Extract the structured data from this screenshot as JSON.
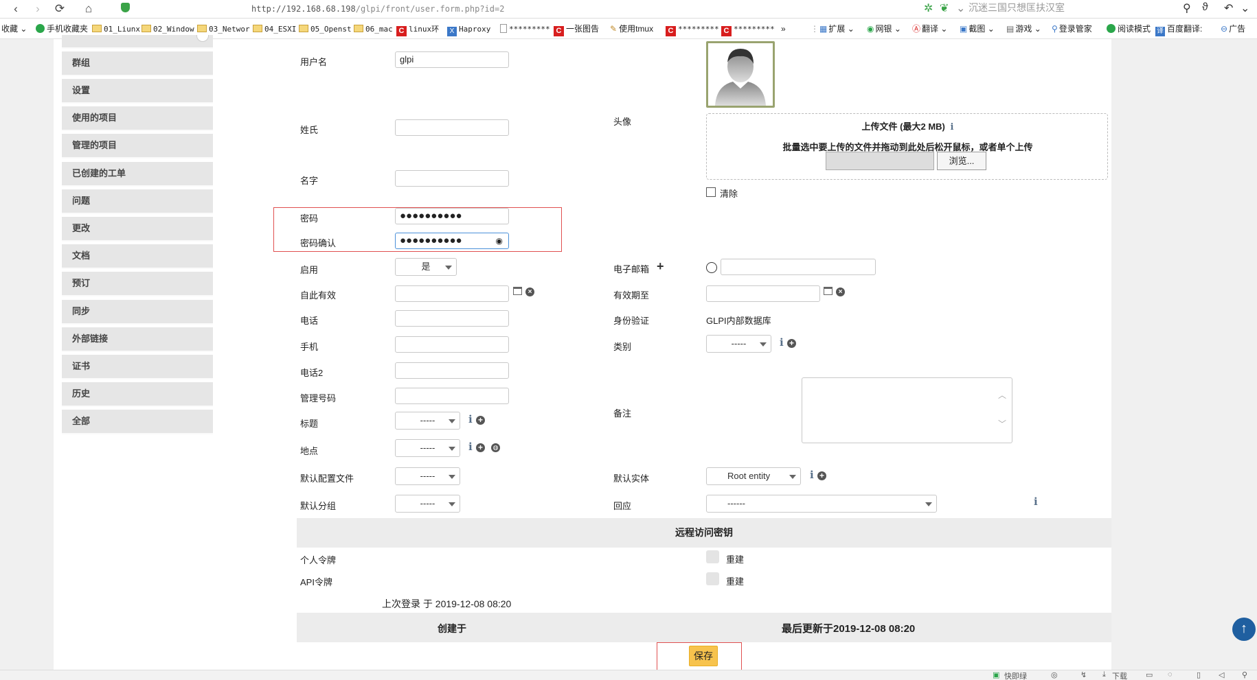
{
  "browser": {
    "url_host": "http://192.168.68.198",
    "url_path": "/glpi/front/user.form.php?id=2",
    "search_text": "沉迷三国只想匡扶汉室"
  },
  "bookmarks": [
    "收藏",
    "手机收藏夹",
    "01_Liunx",
    "02_Window",
    "03_Networ",
    "04_ESXI",
    "05_Openst",
    "06_mac",
    "linux环",
    "Haproxy",
    "*********",
    "一张图告",
    "使用tmux",
    "*********",
    "*********",
    "»",
    "扩展",
    "网银",
    "翻译",
    "截图",
    "游戏",
    "登录管家",
    "阅读模式",
    "百度翻译:",
    "广告"
  ],
  "sidebar": {
    "items": [
      "群组",
      "设置",
      "使用的项目",
      "管理的项目",
      "已创建的工单",
      "问题",
      "更改",
      "文档",
      "预订",
      "同步",
      "外部链接",
      "证书",
      "历史",
      "全部"
    ]
  },
  "form": {
    "username_label": "用户名",
    "username_value": "glpi",
    "avatar_label": "头像",
    "upload_title": "上传文件 (最大2 MB)",
    "upload_hint": "批量选中要上传的文件并拖动到此处后松开鼠标，或者单个上传",
    "browse_label": "浏览...",
    "clear_label": "清除",
    "lastname_label": "姓氏",
    "firstname_label": "名字",
    "password_label": "密码",
    "password_value": "●●●●●●●●●●",
    "password_confirm_label": "密码确认",
    "password_confirm_value": "●●●●●●●●●●",
    "active_label": "启用",
    "active_value": "是",
    "email_label": "电子邮箱",
    "valid_since_label": "自此有效",
    "valid_until_label": "有效期至",
    "phone_label": "电话",
    "auth_label": "身份验证",
    "auth_value": "GLPI内部数据库",
    "mobile_label": "手机",
    "category_label": "类别",
    "category_value": "-----",
    "phone2_label": "电话2",
    "admin_number_label": "管理号码",
    "comments_label": "备注",
    "title_label": "标题",
    "title_value": "-----",
    "location_label": "地点",
    "location_value": "-----",
    "default_profile_label": "默认配置文件",
    "default_profile_value": "-----",
    "default_entity_label": "默认实体",
    "default_entity_value": "Root entity",
    "default_group_label": "默认分组",
    "default_group_value": "-----",
    "responsible_label": "回应",
    "responsible_value": "------"
  },
  "remote": {
    "section_title": "远程访问密钥",
    "personal_token_label": "个人令牌",
    "api_token_label": "API令牌",
    "regenerate_label": "重建"
  },
  "footer": {
    "last_login": "上次登录 于 2019-12-08 08:20",
    "created": "创建于",
    "last_update": "最后更新于2019-12-08 08:20",
    "save_label": "保存"
  },
  "statusbar": {
    "items": [
      "快即绿",
      "下载"
    ]
  }
}
